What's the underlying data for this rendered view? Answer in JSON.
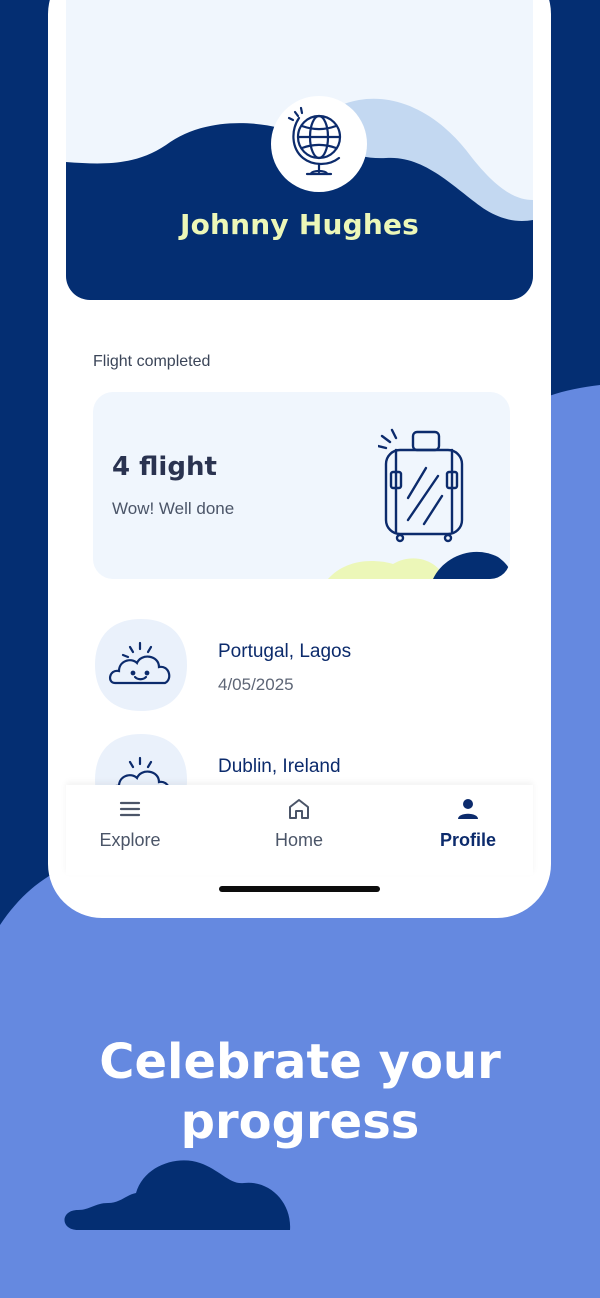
{
  "colors": {
    "background_light": "#6589e0",
    "background_dark": "#042e72",
    "navy": "#0c2b6c",
    "accent_yellow": "#ecf7b8",
    "card_bg": "#f0f6fd",
    "hill_light": "#c3d8f1"
  },
  "profile": {
    "name": "Johnny Hughes",
    "avatar_icon": "globe-icon"
  },
  "stats": {
    "section_label": "Flight completed",
    "count_text": "4 flight",
    "message": "Wow! Well done",
    "icon": "suitcase-icon"
  },
  "trips": [
    {
      "title": "Portugal, Lagos",
      "date": "4/05/2025",
      "icon": "smiling-cloud-icon"
    },
    {
      "title": "Dublin, Ireland",
      "date": "",
      "icon": "smiling-cloud-icon"
    }
  ],
  "tabbar": {
    "tabs": [
      {
        "label": "Explore",
        "icon": "menu-icon",
        "active": false
      },
      {
        "label": "Home",
        "icon": "home-icon",
        "active": false
      },
      {
        "label": "Profile",
        "icon": "person-icon",
        "active": true
      }
    ]
  },
  "promo": {
    "headline_line1": "Celebrate your",
    "headline_line2": "progress"
  }
}
